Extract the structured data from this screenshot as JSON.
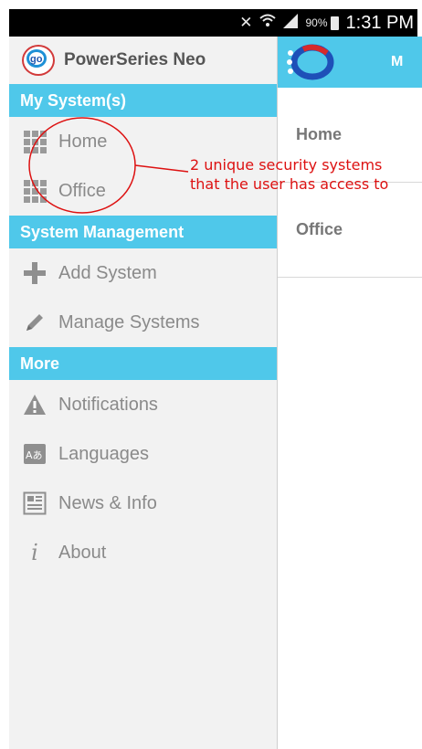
{
  "status_bar": {
    "battery": "90%",
    "time": "1:31 PM",
    "icons": [
      "mute-icon",
      "wifi-icon",
      "signal-icon",
      "battery-icon"
    ]
  },
  "drawer": {
    "app_title": "PowerSeries Neo",
    "logo_text": "go",
    "sections": [
      {
        "title": "My System(s)",
        "items": [
          {
            "label": "Home",
            "icon": "grid-icon"
          },
          {
            "label": "Office",
            "icon": "grid-icon"
          }
        ]
      },
      {
        "title": "System Management",
        "items": [
          {
            "label": "Add System",
            "icon": "plus-icon"
          },
          {
            "label": "Manage Systems",
            "icon": "pencil-icon"
          }
        ]
      },
      {
        "title": "More",
        "items": [
          {
            "label": "Notifications",
            "icon": "warning-icon"
          },
          {
            "label": "Languages",
            "icon": "language-icon"
          },
          {
            "label": "News & Info",
            "icon": "news-icon"
          },
          {
            "label": "About",
            "icon": "info-icon"
          }
        ]
      }
    ]
  },
  "main": {
    "header_letter": "M",
    "rows": [
      "Home",
      "Office"
    ]
  },
  "annotation": {
    "text": "2 unique security systems that the user has access to"
  },
  "colors": {
    "accent": "#4fc8ea",
    "annotation": "#d11111",
    "status_bar": "#000000"
  }
}
